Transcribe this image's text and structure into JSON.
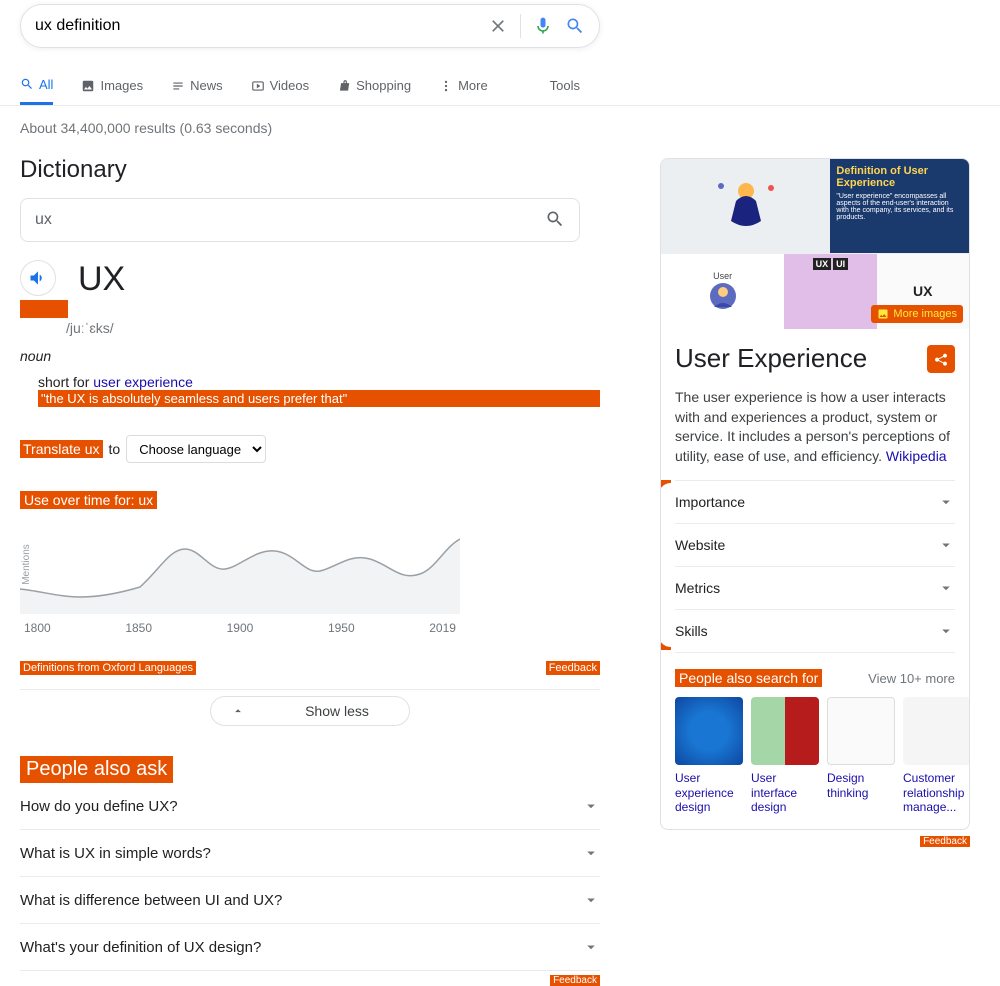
{
  "search": {
    "query": "ux definition"
  },
  "tabs": {
    "all": "All",
    "images": "Images",
    "news": "News",
    "videos": "Videos",
    "shopping": "Shopping",
    "more": "More",
    "tools": "Tools"
  },
  "stats": "About 34,400,000 results (0.63 seconds)",
  "dict": {
    "title": "Dictionary",
    "query": "ux",
    "headword": "UX",
    "pron": "/juːˈɛks/",
    "pos": "noun",
    "def_prefix": "short for ",
    "def_link": "user experience",
    "example": "\"the UX is absolutely seamless and users prefer that\"",
    "translate_label": "Translate ux",
    "to": "to",
    "lang_placeholder": "Choose language",
    "uot": "Use over time for: ux",
    "ylabel": "Mentions",
    "oxford": "Definitions from Oxford Languages",
    "feedback": "Feedback",
    "showless": "Show less"
  },
  "chart_data": {
    "type": "line",
    "title": "Use over time for: ux",
    "xlabel": "",
    "ylabel": "Mentions",
    "x": [
      1800,
      1850,
      1900,
      1950,
      2019
    ],
    "series": [
      {
        "name": "ux",
        "values": [
          18,
          12,
          22,
          20,
          42
        ]
      }
    ],
    "ylim": [
      0,
      50
    ]
  },
  "paa": {
    "heading": "People also ask",
    "q1": "How do you define UX?",
    "q2": "What is UX in simple words?",
    "q3": "What is difference between UI and UX?",
    "q4": "What's your definition of UX design?",
    "feedback": "Feedback"
  },
  "kp": {
    "tile_title": "Definition of User Experience",
    "tile_sub": "\"User experience\" encompasses all aspects of the end-user's interaction with the company, its services, and its products.",
    "tile_user": "User",
    "tile_ux": "UX",
    "tile_ui": "UI",
    "more_images": "More images",
    "title": "User Experience",
    "desc": "The user experience is how a user interacts with and experiences a product, system or service. It includes a person's perceptions of utility, ease of use, and efficiency. ",
    "wiki": "Wikipedia",
    "acc1": "Importance",
    "acc2": "Website",
    "acc3": "Metrics",
    "acc4": "Skills",
    "pasf": "People also search for",
    "viewmore": "View 10+ more",
    "c1": "User experience design",
    "c2": "User interface design",
    "c3": "Design thinking",
    "c4": "Customer relationship manage...",
    "feedback": "Feedback"
  }
}
